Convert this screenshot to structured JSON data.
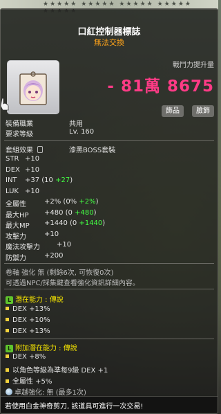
{
  "item": {
    "name": "口紅控制器標誌",
    "trade_status": "無法交換",
    "icon": "lipstick-controller-badge-icon"
  },
  "power": {
    "label": "戰鬥力提升量",
    "value": "- 81萬 8675"
  },
  "tags": [
    "飾品",
    "臉飾"
  ],
  "requirements": {
    "job_label": "裝備職業",
    "job_value": "共用",
    "level_label": "要求等級",
    "level_value": "Lv. 160"
  },
  "set": {
    "label": "套組效果",
    "name": "漆黑BOSS套裝"
  },
  "stats": [
    {
      "label": "STR",
      "base": "+10",
      "extra": ""
    },
    {
      "label": "DEX",
      "base": "+10",
      "extra": ""
    },
    {
      "label": "INT",
      "base": "+37 (10 ",
      "extra": "+27",
      "suffix": ")"
    },
    {
      "label": "LUK",
      "base": "+10",
      "extra": ""
    },
    {
      "label": "全屬性",
      "base": "+2% (0% ",
      "extra": "+2%",
      "suffix": ")"
    },
    {
      "label": "最大HP",
      "base": "+480 (0 ",
      "extra": "+480",
      "suffix": ")"
    },
    {
      "label": "最大MP",
      "base": "+1440 (0 ",
      "extra": "+1440",
      "suffix": ")"
    },
    {
      "label": "攻擊力",
      "base": "+10",
      "extra": ""
    },
    {
      "label": "魔法攻擊力",
      "base": "+10",
      "extra": ""
    },
    {
      "label": "防禦力",
      "base": "+200",
      "extra": ""
    }
  ],
  "enhance": {
    "line1": "卷軸 強化 無 (剩餘6次, 可恢復0次)",
    "line2": "可透過NPC/採集鍵查看強化資訊詳細內容。"
  },
  "potential": {
    "title": "潛在能力 : 傳說",
    "badge": "L",
    "lines": [
      "DEX +13%",
      "DEX +10%",
      "DEX +13%"
    ]
  },
  "bonus_potential": {
    "title": "附加潛在能力 : 傳說",
    "badge": "L",
    "lines": [
      "DEX +8%",
      "以角色等級為準每9級 DEX +1",
      "全屬性 +5%"
    ]
  },
  "soul": {
    "text": "卓越強化: 無 (最多1次)"
  },
  "footer": {
    "text": "若使用白金神奇剪刀, 該道具可進行一次交易!"
  },
  "colors": {
    "power": "#ff3b86",
    "untradable": "#ffa31a",
    "potential_title": "#f5e400",
    "bonus_green": "#44ff44"
  }
}
